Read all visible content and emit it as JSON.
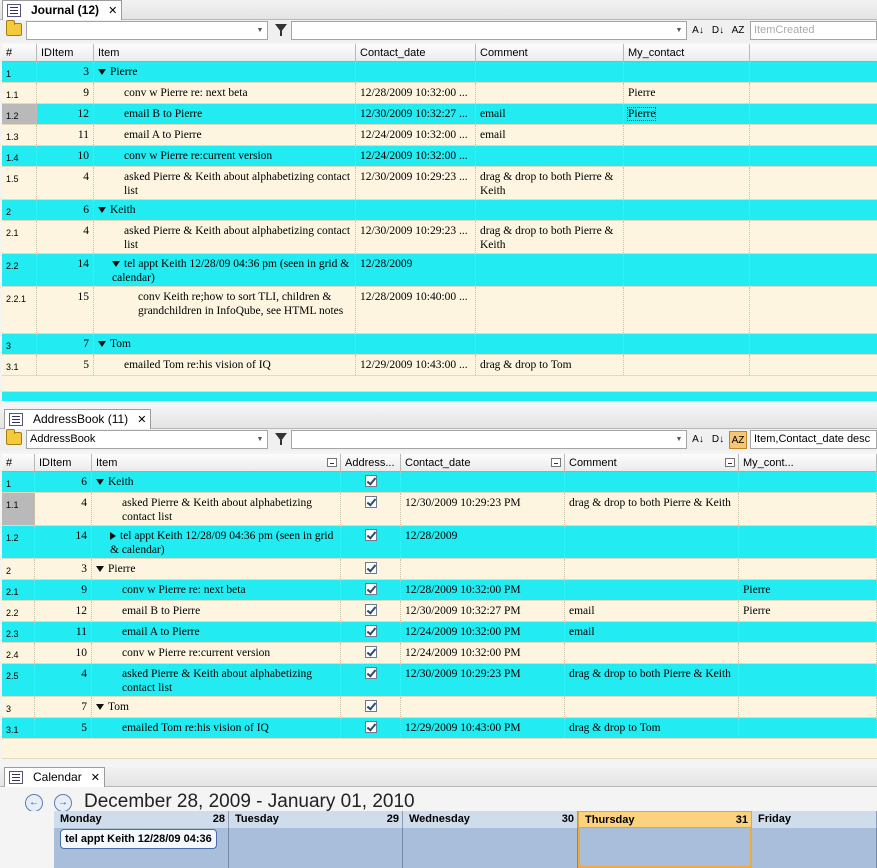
{
  "journal": {
    "tab_label": "Journal (12)",
    "close_glyph": "✕",
    "filter_value": "",
    "query_value": "",
    "sort_value": "ItemCreated",
    "columns": [
      "#",
      "IDItem",
      "Item",
      "Contact_date",
      "Comment",
      "My_contact"
    ],
    "rows": [
      {
        "num": "1",
        "id": "3",
        "item": "Pierre",
        "date": "",
        "comment": "",
        "contact": "",
        "level": 0,
        "expander": "down",
        "color": "cyan"
      },
      {
        "num": "1.1",
        "id": "9",
        "item": "conv w Pierre re: next beta",
        "date": "12/28/2009 10:32:00 ...",
        "comment": "",
        "contact": "Pierre",
        "level": 1,
        "expander": "",
        "color": "cream"
      },
      {
        "num": "1.2",
        "id": "12",
        "item": "email B to Pierre",
        "date": "12/30/2009 10:32:27 ...",
        "comment": "email",
        "contact": "Pierre",
        "level": 1,
        "expander": "",
        "color": "cyan"
      },
      {
        "num": "1.3",
        "id": "11",
        "item": "email A to Pierre",
        "date": "12/24/2009 10:32:00 ...",
        "comment": "email",
        "contact": "",
        "level": 1,
        "expander": "",
        "color": "cream"
      },
      {
        "num": "1.4",
        "id": "10",
        "item": "conv w Pierre re:current version",
        "date": "12/24/2009 10:32:00 ...",
        "comment": "",
        "contact": "",
        "level": 1,
        "expander": "",
        "color": "cyan"
      },
      {
        "num": "1.5",
        "id": "4",
        "item": "asked Pierre & Keith about alphabetizing contact list",
        "date": "12/30/2009 10:29:23 ...",
        "comment": "drag & drop to both Pierre & Keith",
        "contact": "",
        "level": 1,
        "expander": "",
        "color": "cream"
      },
      {
        "num": "2",
        "id": "6",
        "item": "Keith",
        "date": "",
        "comment": "",
        "contact": "",
        "level": 0,
        "expander": "down",
        "color": "cyan"
      },
      {
        "num": "2.1",
        "id": "4",
        "item": "asked Pierre & Keith about alphabetizing contact list",
        "date": "12/30/2009 10:29:23 ...",
        "comment": "drag & drop to both Pierre & Keith",
        "contact": "",
        "level": 1,
        "expander": "",
        "color": "cream"
      },
      {
        "num": "2.2",
        "id": "14",
        "item": "tel appt Keith 12/28/09 04:36 pm (seen in grid & calendar)",
        "date": "12/28/2009",
        "comment": "",
        "contact": "",
        "level": 1,
        "expander": "down",
        "color": "cyan"
      },
      {
        "num": "2.2.1",
        "id": "15",
        "item": "conv Keith re;how to sort TLI, children & grandchildren in InfoQube, see HTML notes",
        "date": "12/28/2009 10:40:00 ...",
        "comment": "",
        "contact": "",
        "level": 2,
        "expander": "",
        "color": "cream"
      },
      {
        "num": "3",
        "id": "7",
        "item": "Tom",
        "date": "",
        "comment": "",
        "contact": "",
        "level": 0,
        "expander": "down",
        "color": "cyan"
      },
      {
        "num": "3.1",
        "id": "5",
        "item": "emailed Tom re:his vision of IQ",
        "date": "12/29/2009 10:43:00 ...",
        "comment": "drag & drop to Tom",
        "contact": "",
        "level": 1,
        "expander": "",
        "color": "cream"
      }
    ]
  },
  "addressbook": {
    "tab_label": "AddressBook (11)",
    "close_glyph": "✕",
    "filter_value": "AddressBook",
    "query_value": "",
    "sort_value": "Item,Contact_date desc",
    "columns": [
      "#",
      "IDItem",
      "Item",
      "Address...",
      "Contact_date",
      "Comment",
      "My_cont..."
    ],
    "rows": [
      {
        "num": "1",
        "id": "6",
        "item": "Keith",
        "check": true,
        "date": "",
        "comment": "",
        "contact": "",
        "level": 0,
        "expander": "down",
        "color": "cyan"
      },
      {
        "num": "1.1",
        "id": "4",
        "item": "asked Pierre & Keith about alphabetizing contact list",
        "check": true,
        "date": "12/30/2009 10:29:23 PM",
        "comment": "drag & drop to both Pierre & Keith",
        "contact": "",
        "level": 1,
        "expander": "",
        "color": "cream"
      },
      {
        "num": "1.2",
        "id": "14",
        "item": "tel appt Keith 12/28/09 04:36 pm (seen in grid & calendar)",
        "check": true,
        "date": "12/28/2009",
        "comment": "",
        "contact": "",
        "level": 1,
        "expander": "right",
        "color": "cyan"
      },
      {
        "num": "2",
        "id": "3",
        "item": "Pierre",
        "check": true,
        "date": "",
        "comment": "",
        "contact": "",
        "level": 0,
        "expander": "down",
        "color": "cream"
      },
      {
        "num": "2.1",
        "id": "9",
        "item": "conv w Pierre re: next beta",
        "check": true,
        "date": "12/28/2009 10:32:00 PM",
        "comment": "",
        "contact": "Pierre",
        "level": 1,
        "expander": "",
        "color": "cyan"
      },
      {
        "num": "2.2",
        "id": "12",
        "item": "email B to Pierre",
        "check": true,
        "date": "12/30/2009 10:32:27 PM",
        "comment": "email",
        "contact": "Pierre",
        "level": 1,
        "expander": "",
        "color": "cream"
      },
      {
        "num": "2.3",
        "id": "11",
        "item": "email A to Pierre",
        "check": true,
        "date": "12/24/2009 10:32:00 PM",
        "comment": "email",
        "contact": "",
        "level": 1,
        "expander": "",
        "color": "cyan"
      },
      {
        "num": "2.4",
        "id": "10",
        "item": "conv w Pierre re:current version",
        "check": true,
        "date": "12/24/2009 10:32:00 PM",
        "comment": "",
        "contact": "",
        "level": 1,
        "expander": "",
        "color": "cream"
      },
      {
        "num": "2.5",
        "id": "4",
        "item": "asked Pierre & Keith about alphabetizing contact list",
        "check": true,
        "date": "12/30/2009 10:29:23 PM",
        "comment": "drag & drop to both Pierre & Keith",
        "contact": "",
        "level": 1,
        "expander": "",
        "color": "cyan"
      },
      {
        "num": "3",
        "id": "7",
        "item": "Tom",
        "check": true,
        "date": "",
        "comment": "",
        "contact": "",
        "level": 0,
        "expander": "down",
        "color": "cream"
      },
      {
        "num": "3.1",
        "id": "5",
        "item": "emailed Tom re:his vision of IQ",
        "check": true,
        "date": "12/29/2009 10:43:00 PM",
        "comment": "drag & drop to Tom",
        "contact": "",
        "level": 1,
        "expander": "",
        "color": "cyan"
      }
    ]
  },
  "calendar": {
    "tab_label": "Calendar",
    "close_glyph": "✕",
    "prev_glyph": "←",
    "next_glyph": "→",
    "range_title": "December 28, 2009 - January 01, 2010",
    "days": [
      {
        "name": "Monday",
        "date": "28"
      },
      {
        "name": "Tuesday",
        "date": "29"
      },
      {
        "name": "Wednesday",
        "date": "30"
      },
      {
        "name": "Thursday",
        "date": "31",
        "today": true
      },
      {
        "name": "Friday",
        "date": ""
      }
    ],
    "appointment": "tel appt Keith 12/28/09 04:36"
  },
  "colors": {
    "row_cyan": "#22ecf2",
    "row_cream": "#fdf5e0",
    "today": "#fbd37e"
  }
}
